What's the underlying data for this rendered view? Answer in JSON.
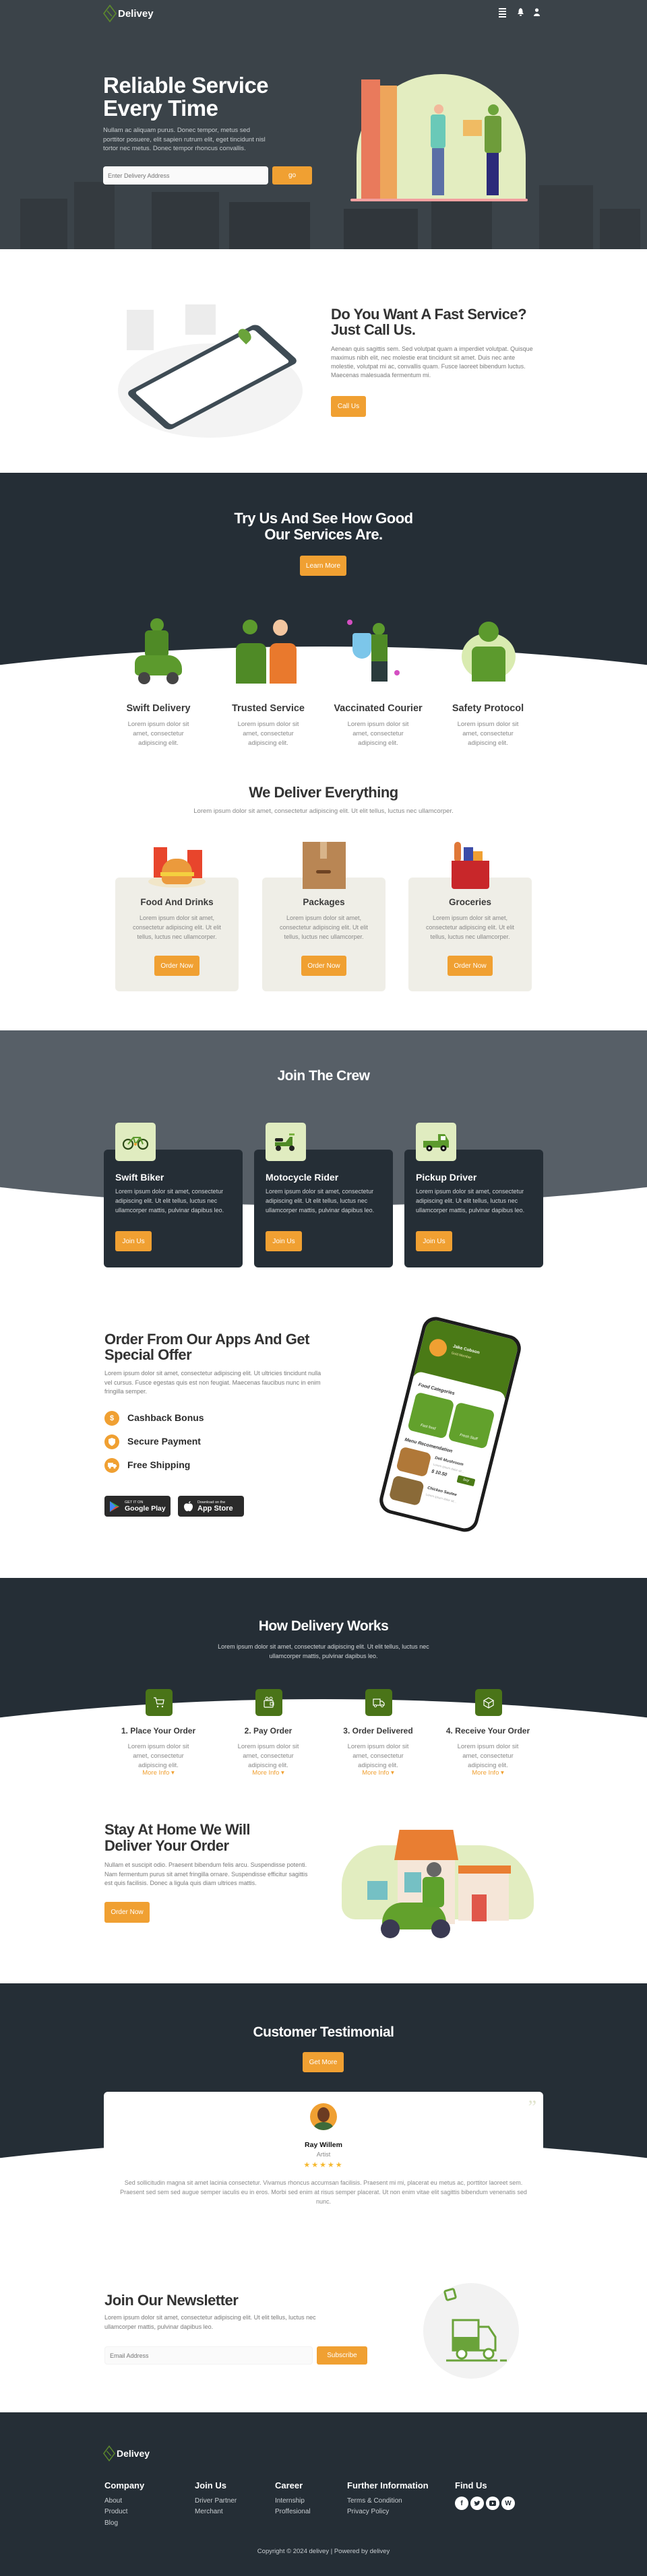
{
  "nav": {
    "brand": "Delivey",
    "icons": [
      "menu-icon",
      "bell-icon",
      "user-icon"
    ]
  },
  "hero": {
    "title_line1": "Reliable Service",
    "title_line2": "Every Time",
    "text": "Nullam ac aliquam purus. Donec tempor, metus sed porttitor posuere, elit sapien rutrum elit, eget tincidunt nisl tortor nec metus. Donec tempor rhoncus convallis.",
    "address_placeholder": "Enter Delivery Address",
    "go_label": "go"
  },
  "fast": {
    "title_line1": "Do You Want A Fast Service?",
    "title_line2": "Just Call Us.",
    "text": "Aenean quis sagittis sem. Sed volutpat quam a imperdiet volutpat. Quisque maximus nibh elit, nec molestie erat tincidunt sit amet. Duis nec ante molestie, volutpat mi ac, convallis quam. Fusce laoreet bibendum luctus. Maecenas malesuada fermentum mi.",
    "button": "Call Us"
  },
  "try_us": {
    "title_line1": "Try Us And See How Good",
    "title_line2": "Our Services Are.",
    "button": "Learn More",
    "services": [
      {
        "title": "Swift Delivery",
        "text": "Lorem ipsum dolor sit amet, consectetur adipiscing elit."
      },
      {
        "title": "Trusted Service",
        "text": "Lorem ipsum dolor sit amet, consectetur adipiscing elit."
      },
      {
        "title": "Vaccinated Courier",
        "text": "Lorem ipsum dolor sit amet, consectetur adipiscing elit."
      },
      {
        "title": "Safety Protocol",
        "text": "Lorem ipsum dolor sit amet, consectetur adipiscing elit."
      }
    ]
  },
  "deliver": {
    "title": "We Deliver Everything",
    "subtitle": "Lorem ipsum dolor sit amet, consectetur adipiscing elit. Ut elit tellus, luctus nec ullamcorper.",
    "cards": [
      {
        "title": "Food And Drinks",
        "text": "Lorem ipsum dolor sit amet, consectetur adipiscing elit. Ut elit tellus, luctus nec ullamcorper.",
        "button": "Order Now"
      },
      {
        "title": "Packages",
        "text": "Lorem ipsum dolor sit amet, consectetur adipiscing elit. Ut elit tellus, luctus nec ullamcorper.",
        "button": "Order Now"
      },
      {
        "title": "Groceries",
        "text": "Lorem ipsum dolor sit amet, consectetur adipiscing elit. Ut elit tellus, luctus nec ullamcorper.",
        "button": "Order Now"
      }
    ]
  },
  "crew": {
    "title": "Join The Crew",
    "cards": [
      {
        "title": "Swift Biker",
        "icon": "bicycle-icon",
        "text": "Lorem ipsum dolor sit amet, consectetur adipiscing elit. Ut elit tellus, luctus nec ullamcorper mattis, pulvinar dapibus leo.",
        "button": "Join Us"
      },
      {
        "title": "Motocycle Rider",
        "icon": "scooter-icon",
        "text": "Lorem ipsum dolor sit amet, consectetur adipiscing elit. Ut elit tellus, luctus nec ullamcorper mattis, pulvinar dapibus leo.",
        "button": "Join Us"
      },
      {
        "title": "Pickup Driver",
        "icon": "pickup-truck-icon",
        "text": "Lorem ipsum dolor sit amet, consectetur adipiscing elit. Ut elit tellus, luctus nec ullamcorper mattis, pulvinar dapibus leo.",
        "button": "Join Us"
      }
    ]
  },
  "apps": {
    "title_line1": "Order From Our Apps And Get",
    "title_line2": "Special Offer",
    "text": "Lorem ipsum dolor sit amet, consectetur adipiscing elit. Ut ultricies tincidunt nulla vel cursus. Fusce egestas quis est non feugiat. Maecenas faucibus nunc in enim fringilla semper.",
    "features": [
      {
        "label": "Cashback Bonus",
        "icon": "dollar-icon"
      },
      {
        "label": "Secure Payment",
        "icon": "shield-icon"
      },
      {
        "label": "Free Shipping",
        "icon": "truck-icon"
      }
    ],
    "google_play": {
      "small": "GET IT ON",
      "big": "Google Play"
    },
    "app_store": {
      "small": "Download on the",
      "big": "App Store"
    },
    "phone": {
      "user_name": "Jake Cobson",
      "badge": "Gold Member",
      "categories_title": "Food Categories",
      "category1": "Fast food",
      "category2": "Fresh Stuff",
      "menu_title": "Menu Recomendation",
      "item1_name": "Deli Mushroom",
      "item1_desc": "Lorem ipsum dolor sit...",
      "item1_price": "$ 10.50",
      "buy_label": "buy",
      "item2_name": "Chicken Sautee",
      "item2_desc": "Lorem ipsum dolor sit..."
    }
  },
  "how": {
    "title": "How Delivery Works",
    "subtitle": "Lorem ipsum dolor sit amet, consectetur adipiscing elit. Ut elit tellus, luctus nec ullamcorper mattis, pulvinar dapibus leo.",
    "more_info": "More Info",
    "steps": [
      {
        "title": "1. Place Your Order",
        "icon": "cart-icon",
        "text": "Lorem ipsum dolor sit amet, consectetur adipiscing elit."
      },
      {
        "title": "2. Pay Order",
        "icon": "wallet-icon",
        "text": "Lorem ipsum dolor sit amet, consectetur adipiscing elit."
      },
      {
        "title": "3. Order Delivered",
        "icon": "truck-icon",
        "text": "Lorem ipsum dolor sit amet, consectetur adipiscing elit."
      },
      {
        "title": "4. Receive Your Order",
        "icon": "box-icon",
        "text": "Lorem ipsum dolor sit amet, consectetur adipiscing elit."
      }
    ]
  },
  "stay": {
    "title_line1": "Stay At Home We Will",
    "title_line2": "Deliver Your Order",
    "text": "Nullam et suscipit odio. Praesent bibendum felis arcu. Suspendisse potenti. Nam fermentum purus sit amet fringilla ornare. Suspendisse efficitur sagittis est quis facilisis. Donec a ligula quis diam ultrices mattis.",
    "button": "Order Now"
  },
  "testimonial": {
    "title": "Customer Testimonial",
    "button": "Get More",
    "name": "Ray Willem",
    "role": "Artist",
    "rating": 5,
    "stars": "★★★★★",
    "text": "Sed sollicitudin magna sit amet lacinia consectetur. Vivamus rhoncus accumsan facilisis. Praesent mi mi, placerat eu metus ac, porttitor laoreet sem. Praesent sed sem sed augue semper iaculis eu in eros. Morbi sed enim at risus semper placerat. Ut non enim vitae elit sagittis bibendum venenatis sed nunc."
  },
  "newsletter": {
    "title": "Join Our Newsletter",
    "text": "Lorem ipsum dolor sit amet, consectetur adipiscing elit. Ut elit tellus, luctus nec ullamcorper mattis, pulvinar dapibus leo.",
    "email_placeholder": "Email Address",
    "button": "Subscribe"
  },
  "footer": {
    "brand": "Delivey",
    "columns": [
      {
        "title": "Company",
        "links": [
          "About",
          "Product",
          "Blog"
        ]
      },
      {
        "title": "Join Us",
        "links": [
          "Driver Partner",
          "Merchant"
        ]
      },
      {
        "title": "Career",
        "links": [
          "Internship",
          "Proffesional"
        ]
      },
      {
        "title": "Further Information",
        "links": [
          "Terms & Condition",
          "Privacy Policy"
        ]
      },
      {
        "title": "Find Us",
        "social": [
          "facebook-icon",
          "twitter-icon",
          "youtube-icon",
          "wordpress-icon"
        ]
      }
    ],
    "copyright": "Copyright © 2024 delivey | Powered by delivey"
  },
  "colors": {
    "accent": "#f0a032",
    "dark": "#252e36",
    "hero_bg": "#3b4349",
    "crew_bg": "#575f67",
    "green": "#4a7418",
    "light_green": "#e0ecc0",
    "card_bg": "#efeee7"
  }
}
